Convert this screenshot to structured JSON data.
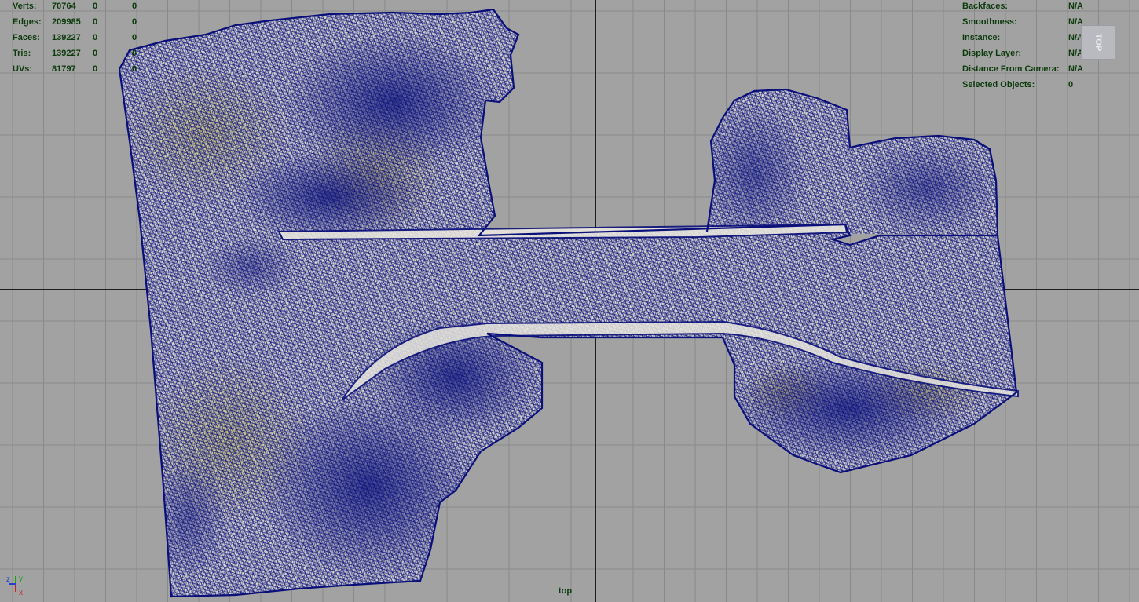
{
  "hud_left": {
    "rows": [
      {
        "label": "Verts:",
        "v1": "70764",
        "v2": "0",
        "v3": "0"
      },
      {
        "label": "Edges:",
        "v1": "209985",
        "v2": "0",
        "v3": "0"
      },
      {
        "label": "Faces:",
        "v1": "139227",
        "v2": "0",
        "v3": "0"
      },
      {
        "label": "Tris:",
        "v1": "139227",
        "v2": "0",
        "v3": "0"
      },
      {
        "label": "UVs:",
        "v1": "81797",
        "v2": "0",
        "v3": "0"
      }
    ]
  },
  "hud_right": {
    "rows": [
      {
        "label": "Backfaces:",
        "value": "N/A"
      },
      {
        "label": "Smoothness:",
        "value": "N/A"
      },
      {
        "label": "Instance:",
        "value": "N/A"
      },
      {
        "label": "Display Layer:",
        "value": "N/A"
      },
      {
        "label": "Distance From Camera:",
        "value": "N/A"
      },
      {
        "label": "Selected Objects:",
        "value": "0"
      }
    ]
  },
  "view_cube": {
    "label": "TOP"
  },
  "camera": {
    "name": "top"
  },
  "gizmo": {
    "x": "x",
    "y": "y",
    "z": "z"
  },
  "colors": {
    "grid_bg": "#a2a2a2",
    "grid_line": "#8a8a8a",
    "axis_line": "#1d1d1d",
    "wire": "#0a0f7a",
    "texture_light": "#e4e2d6",
    "texture_olive": "#bdb672",
    "hud_text": "#0c3a0c"
  }
}
